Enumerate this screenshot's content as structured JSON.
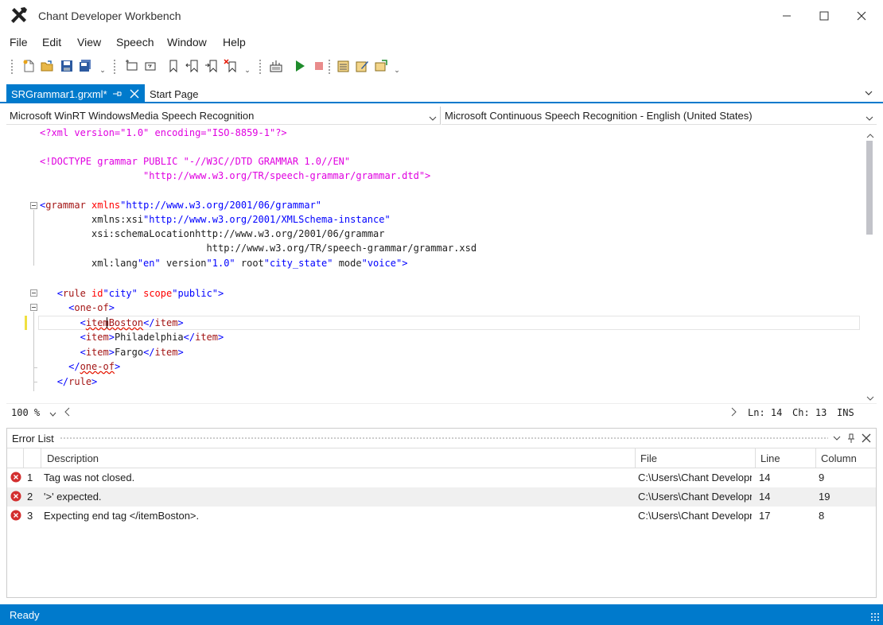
{
  "window": {
    "title": "Chant Developer Workbench",
    "app_icon": "crossed-tools-icon"
  },
  "menu": [
    "File",
    "Edit",
    "View",
    "Speech",
    "Window",
    "Help"
  ],
  "toolbar": {
    "icons": [
      "new-file-icon",
      "open-folder-icon",
      "save-icon",
      "save-all-icon",
      "add-rule-icon",
      "remove-rule-icon",
      "bookmark-icon",
      "previous-bookmark-icon",
      "next-bookmark-icon",
      "clear-bookmarks-icon",
      "build-grammar-icon",
      "run-icon",
      "stop-icon",
      "properties-icon",
      "edit-properties-icon",
      "export-icon"
    ]
  },
  "tabs": {
    "active": "SRGrammar1.grxml*",
    "inactive": "Start Page"
  },
  "engines": {
    "recognizer": "Microsoft WinRT WindowsMedia Speech Recognition",
    "voice": "Microsoft Continuous Speech Recognition - English (United States)"
  },
  "editor": {
    "lines": [
      "<?xml version=\"1.0\" encoding=\"ISO-8859-1\"?>",
      "",
      "<!DOCTYPE grammar PUBLIC \"-//W3C//DTD GRAMMAR 1.0//EN\"",
      "                  \"http://www.w3.org/TR/speech-grammar/grammar.dtd\">",
      "",
      "<grammar xmlns=\"http://www.w3.org/2001/06/grammar\"",
      "         xmlns:xsi=\"http://www.w3.org/2001/XMLSchema-instance\"",
      "         xsi:schemaLocation=\"http://www.w3.org/2001/06/grammar",
      "                             http://www.w3.org/TR/speech-grammar/grammar.xsd\"",
      "         xml:lang=\"en\" version=\"1.0\" root=\"city_state\" mode=\"voice\">",
      "",
      "   <rule id=\"city\" scope=\"public\">",
      "     <one-of>",
      "       <itemBoston</item>",
      "       <item>Philadelphia</item>",
      "       <item>Fargo</item>",
      "     </one-of>",
      "   </rule>"
    ],
    "zoom": "100 %",
    "line_label": "Ln: 14",
    "char_label": "Ch: 13",
    "mode": "INS"
  },
  "error_list": {
    "title": "Error List",
    "columns": [
      "Description",
      "File",
      "Line",
      "Column"
    ],
    "rows": [
      {
        "num": "1",
        "description": "Tag was not closed.",
        "file": "C:\\Users\\Chant Developn",
        "line": "14",
        "column": "9"
      },
      {
        "num": "2",
        "description": "'>' expected.",
        "file": "C:\\Users\\Chant Developn",
        "line": "14",
        "column": "19"
      },
      {
        "num": "3",
        "description": "Expecting end tag </itemBoston>.",
        "file": "C:\\Users\\Chant Developn",
        "line": "17",
        "column": "8"
      }
    ]
  },
  "status": {
    "text": "Ready",
    "accent": "#007acc"
  }
}
